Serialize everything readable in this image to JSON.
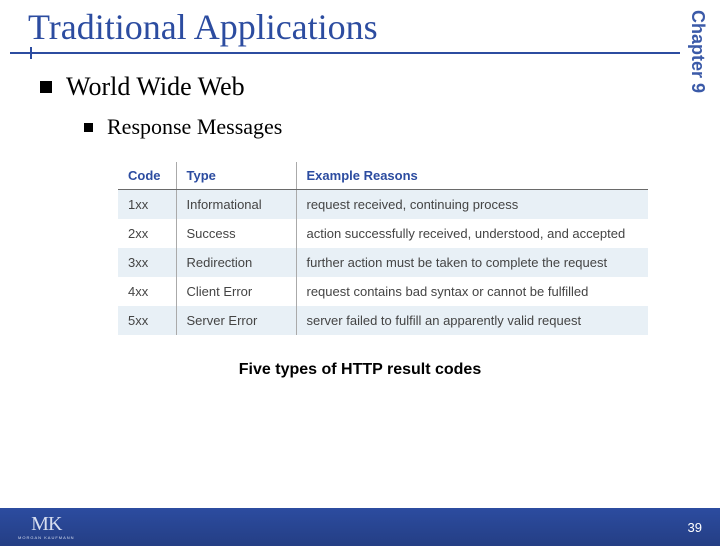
{
  "chapter_label": "Chapter 9",
  "title": "Traditional Applications",
  "outline": {
    "level1": "World Wide Web",
    "level2": "Response Messages"
  },
  "chart_data": {
    "type": "table",
    "title": "Five types of HTTP result codes",
    "columns": [
      "Code",
      "Type",
      "Example Reasons"
    ],
    "rows": [
      {
        "code": "1xx",
        "type": "Informational",
        "reason": "request received, continuing process"
      },
      {
        "code": "2xx",
        "type": "Success",
        "reason": "action successfully received, understood, and accepted"
      },
      {
        "code": "3xx",
        "type": "Redirection",
        "reason": "further action must be taken to complete the request"
      },
      {
        "code": "4xx",
        "type": "Client Error",
        "reason": "request contains bad syntax or cannot be fulfilled"
      },
      {
        "code": "5xx",
        "type": "Server Error",
        "reason": "server failed to fulfill an apparently valid request"
      }
    ]
  },
  "caption": "Five types of HTTP result codes",
  "footer": {
    "logo_main": "MK",
    "logo_sub": "MORGAN KAUFMANN",
    "page": "39"
  }
}
